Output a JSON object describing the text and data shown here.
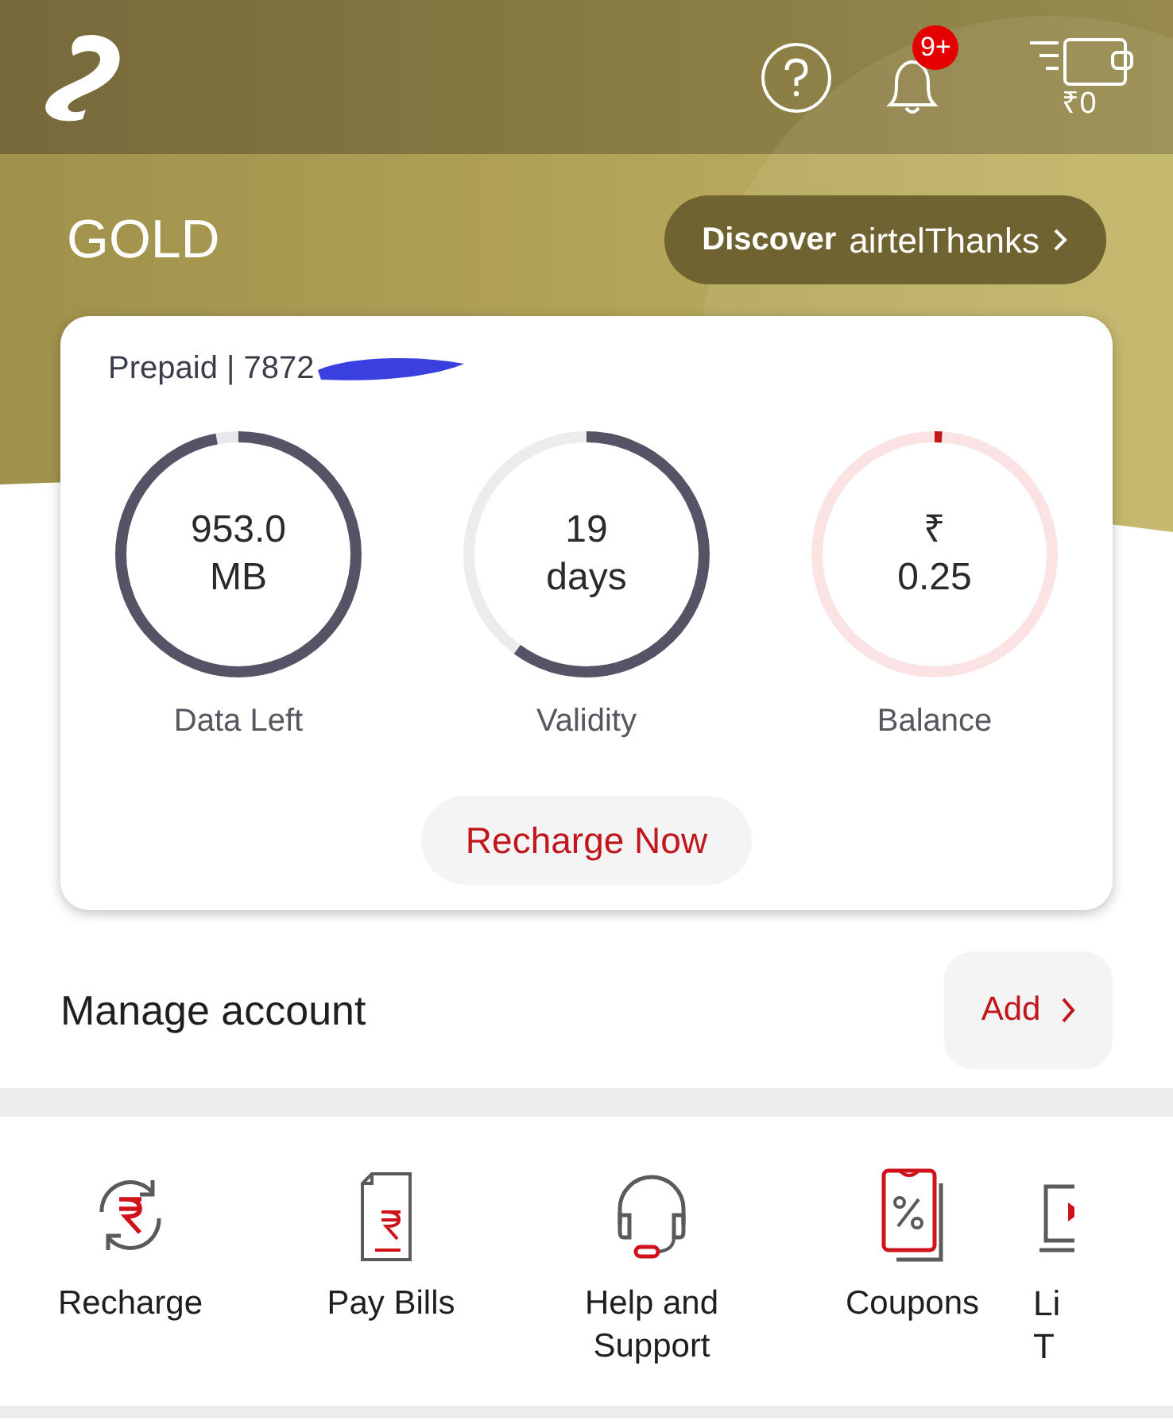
{
  "header": {
    "notification_badge": "9+",
    "wallet_amount": "₹0"
  },
  "tier": "GOLD",
  "discover_button": {
    "prefix": "Discover",
    "brand": "airtelThanks"
  },
  "account_card": {
    "line": "Prepaid | 7872",
    "meters": [
      {
        "kind": "data",
        "value": "953.0",
        "unit": "MB",
        "label": "Data Left",
        "level": 0.97
      },
      {
        "kind": "validity",
        "value": "19",
        "unit": "days",
        "label": "Validity",
        "level": 0.6
      },
      {
        "kind": "balance",
        "value": "₹",
        "unit": "0.25",
        "label": "Balance",
        "level": 0.01
      }
    ],
    "action": "Recharge Now"
  },
  "manage": {
    "title": "Manage account",
    "action": "Add"
  },
  "quick_actions": [
    {
      "kind": "recharge",
      "label": "Recharge"
    },
    {
      "kind": "bills",
      "label": "Pay Bills"
    },
    {
      "kind": "help",
      "label": "Help and Support"
    },
    {
      "kind": "coupons",
      "label": "Coupons"
    },
    {
      "kind": "tv",
      "label": "Li T"
    }
  ]
}
